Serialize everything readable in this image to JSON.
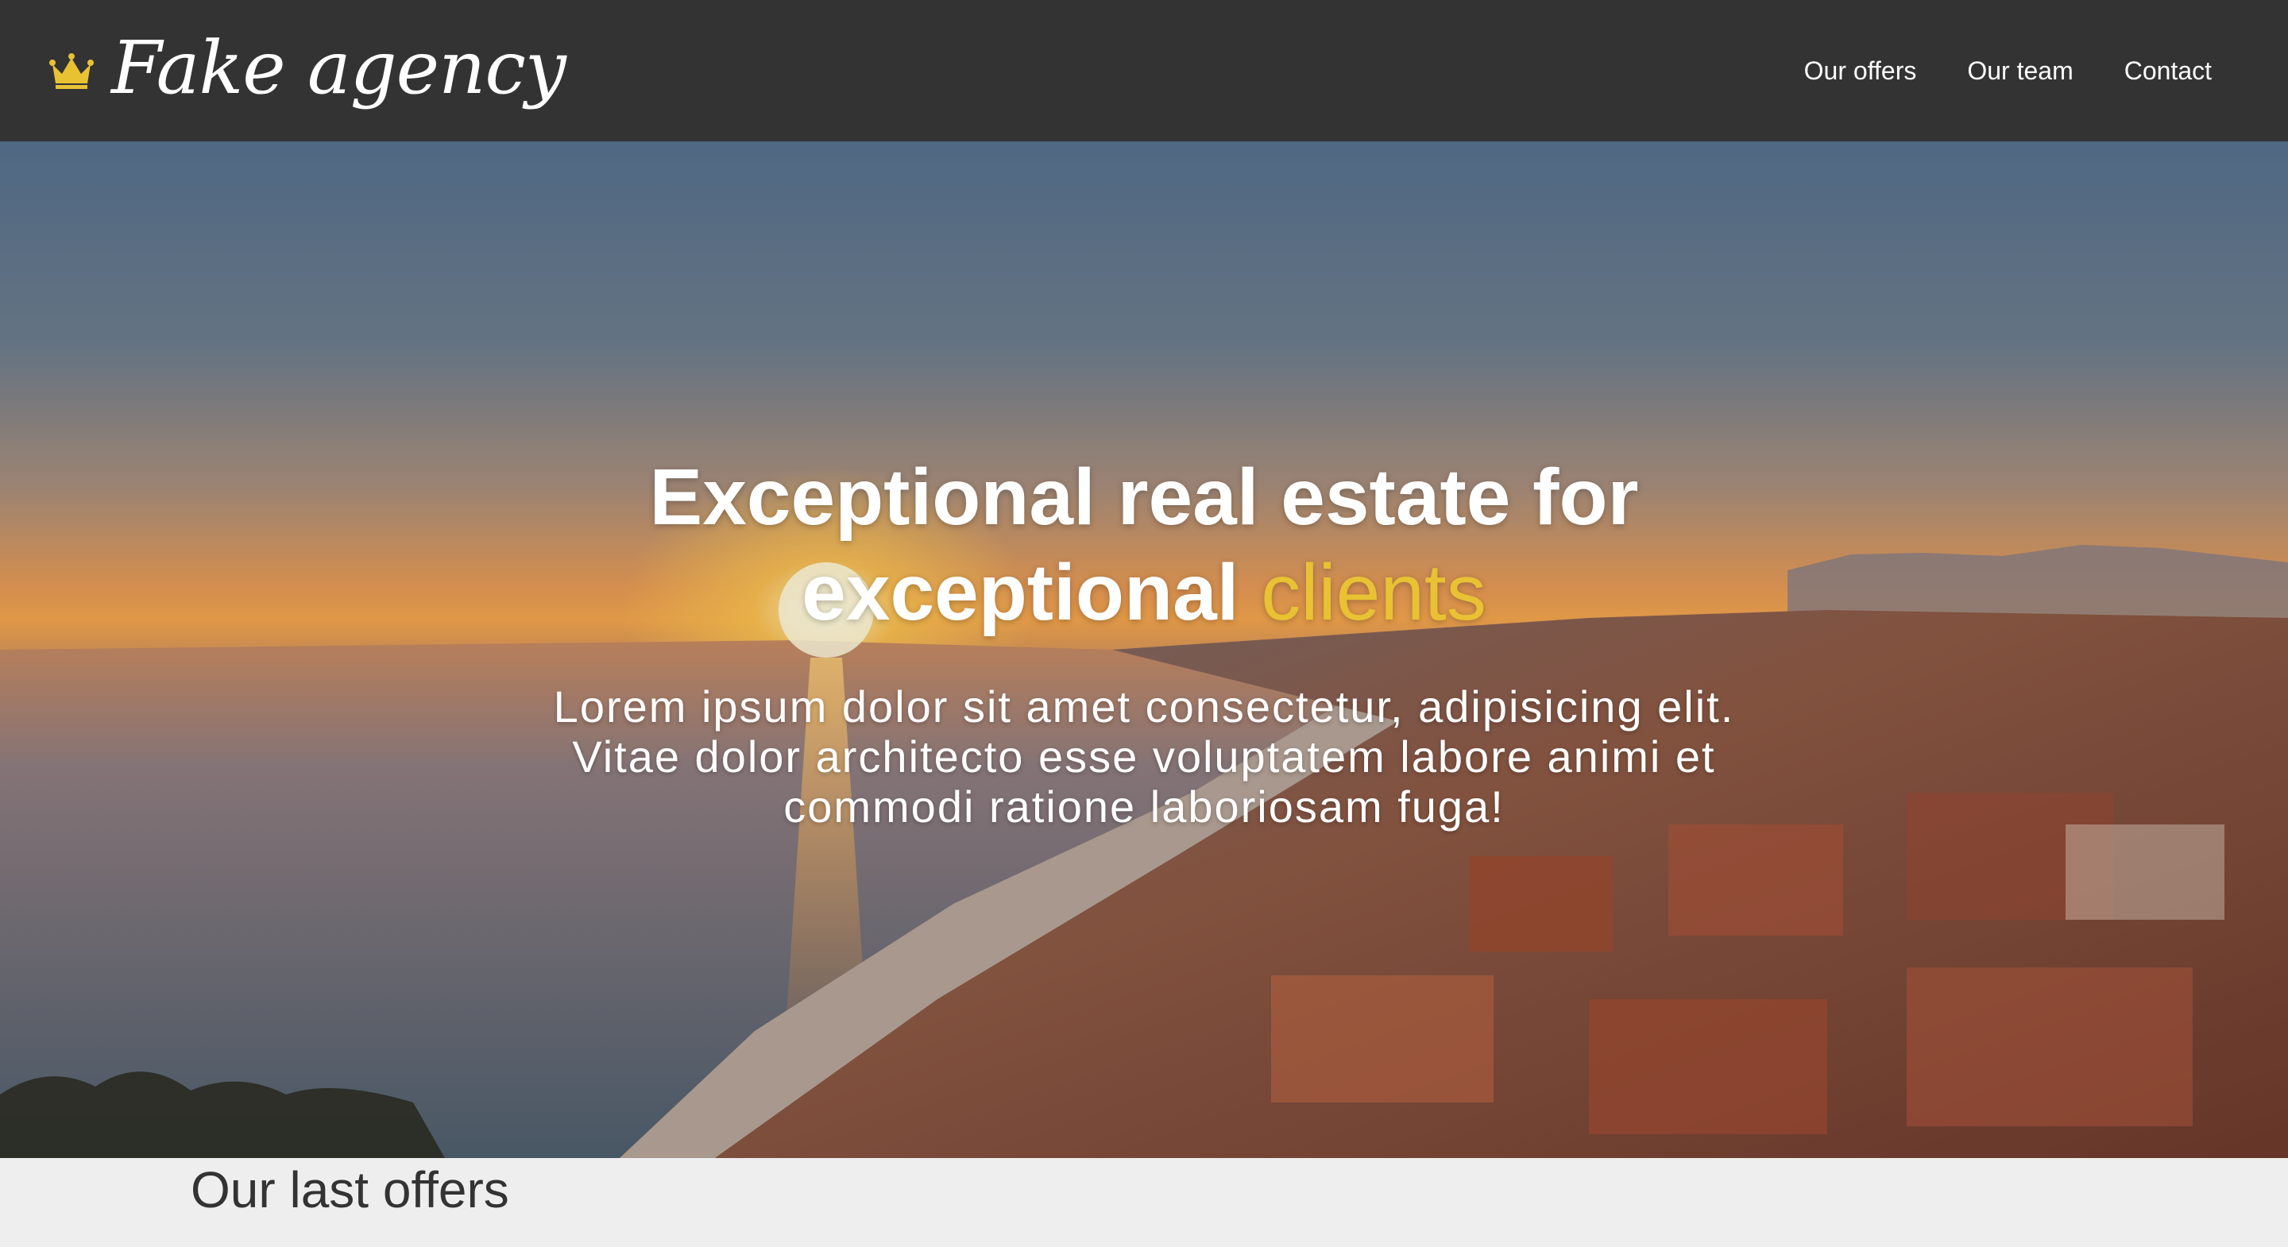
{
  "navbar": {
    "brand_icon": "crown-icon",
    "brand_name": "Fake agency",
    "links": [
      {
        "label": "Our offers"
      },
      {
        "label": "Our team"
      },
      {
        "label": "Contact"
      }
    ]
  },
  "hero": {
    "title_line1": "Exceptional real estate for",
    "title_line2_main": "exceptional",
    "title_line2_accent": "clients",
    "text": "Lorem ipsum dolor sit amet consectetur, adipisicing elit. Vitae dolor architecto esse voluptatem labore animi et commodi ratione laboriosam fuga!"
  },
  "offers": {
    "heading": "Our last offers"
  },
  "colors": {
    "navbar_bg": "#333333",
    "accent": "#e8c233",
    "page_bg": "#eeeeee",
    "text_dark": "#333333"
  }
}
